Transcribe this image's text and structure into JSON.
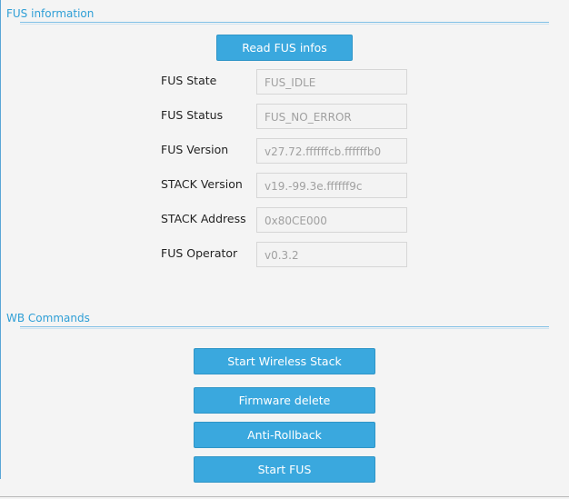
{
  "fus_section": {
    "title": "FUS information",
    "read_button": "Read FUS infos",
    "fields": [
      {
        "label": "FUS State",
        "value": "FUS_IDLE"
      },
      {
        "label": "FUS Status",
        "value": "FUS_NO_ERROR"
      },
      {
        "label": "FUS Version",
        "value": "v27.72.ffffffcb.ffffffb0"
      },
      {
        "label": "STACK Version",
        "value": "v19.-99.3e.ffffff9c"
      },
      {
        "label": "STACK Address",
        "value": "0x80CE000"
      },
      {
        "label": "FUS Operator",
        "value": "v0.3.2"
      }
    ]
  },
  "wb_section": {
    "title": "WB Commands",
    "buttons": {
      "start_wireless_stack": "Start Wireless Stack",
      "firmware_delete": "Firmware delete",
      "anti_rollback": "Anti-Rollback",
      "start_fus": "Start FUS"
    }
  },
  "colors": {
    "accent": "#3aa8de",
    "section_title": "#2f9fd6",
    "background": "#f4f4f4"
  }
}
